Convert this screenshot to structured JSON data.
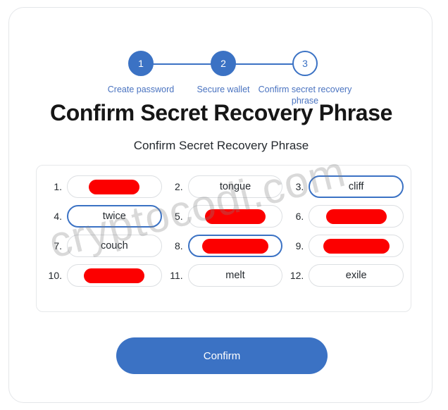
{
  "theme": {
    "accent_blue": "#3b72c4",
    "step_label_blue": "#4a73c0",
    "redaction_red": "#fc0000",
    "card_border": "#e4e6e9",
    "pill_border": "#dcdfe2",
    "text_dark": "#24292e",
    "title_black": "#161616",
    "page_background": "#ffffff"
  },
  "stepper": {
    "steps": [
      {
        "number": "1",
        "label": "Create password",
        "state": "done"
      },
      {
        "number": "2",
        "label": "Secure wallet",
        "state": "done"
      },
      {
        "number": "3",
        "label": "Confirm secret recovery phrase",
        "state": "current"
      }
    ]
  },
  "header": {
    "title": "Confirm Secret Recovery Phrase",
    "subtitle": "Confirm Secret Recovery Phrase"
  },
  "seed_phrase": {
    "words": [
      {
        "index": "1.",
        "word": "",
        "redacted": true,
        "selected": false,
        "redaction_width": 72
      },
      {
        "index": "2.",
        "word": "tongue",
        "redacted": false,
        "selected": false,
        "redaction_width": 0
      },
      {
        "index": "3.",
        "word": "cliff",
        "redacted": false,
        "selected": true,
        "redaction_width": 0
      },
      {
        "index": "4.",
        "word": "twice",
        "redacted": false,
        "selected": true,
        "redaction_width": 0
      },
      {
        "index": "5.",
        "word": "",
        "redacted": true,
        "selected": false,
        "redaction_width": 86
      },
      {
        "index": "6.",
        "word": "",
        "redacted": true,
        "selected": false,
        "redaction_width": 86
      },
      {
        "index": "7.",
        "word": "couch",
        "redacted": false,
        "selected": false,
        "redaction_width": 0
      },
      {
        "index": "8.",
        "word": "",
        "redacted": true,
        "selected": true,
        "redaction_width": 94
      },
      {
        "index": "9.",
        "word": "",
        "redacted": true,
        "selected": false,
        "redaction_width": 94
      },
      {
        "index": "10.",
        "word": "",
        "redacted": true,
        "selected": false,
        "redaction_width": 86
      },
      {
        "index": "11.",
        "word": "melt",
        "redacted": false,
        "selected": false,
        "redaction_width": 0
      },
      {
        "index": "12.",
        "word": "exile",
        "redacted": false,
        "selected": false,
        "redaction_width": 0
      }
    ]
  },
  "actions": {
    "confirm_label": "Confirm"
  },
  "watermark": {
    "text": "cryptocodi.com"
  }
}
